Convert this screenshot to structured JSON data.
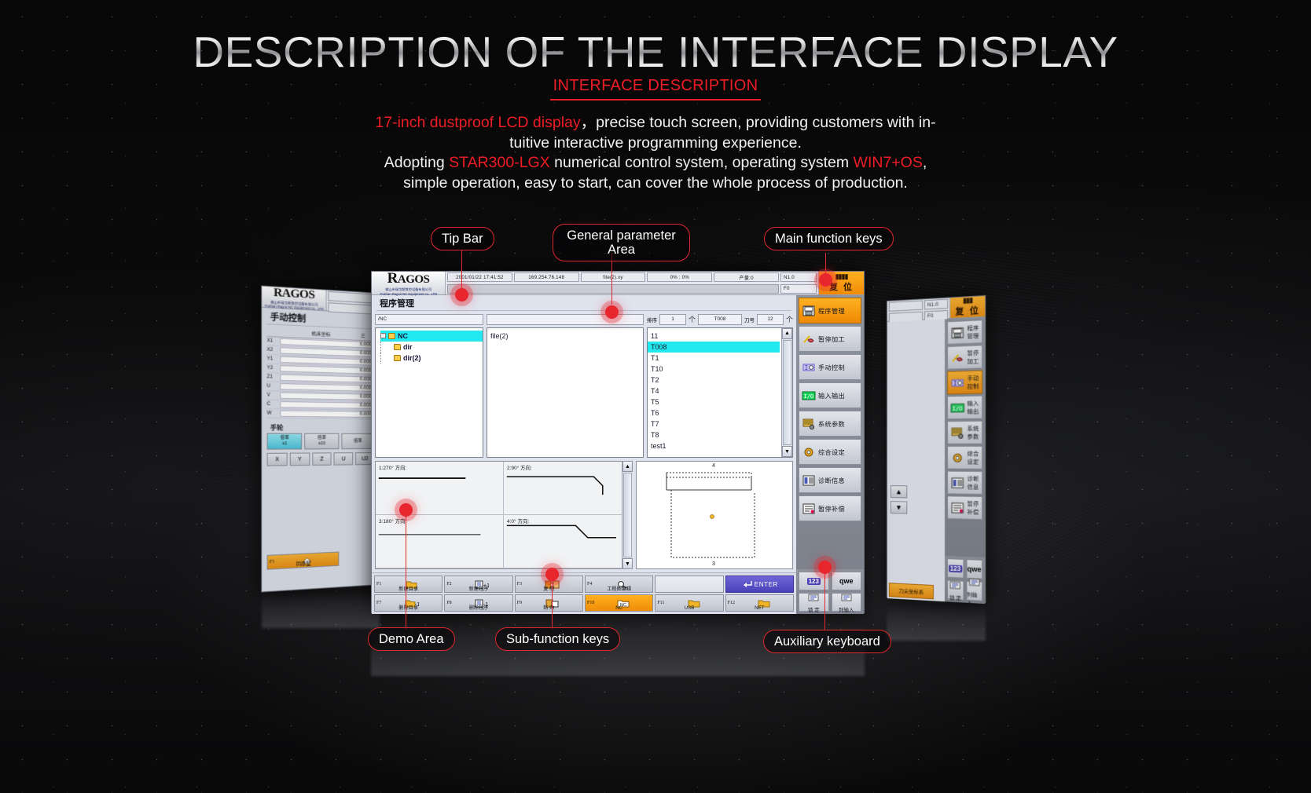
{
  "header": {
    "title": "DESCRIPTION OF THE INTERFACE DISPLAY",
    "subtitle": "INTERFACE DESCRIPTION",
    "para_line1_red": "17-inch dustproof LCD display",
    "para_line1_rest": "，precise touch screen, providing customers with in-",
    "para_line2": "tuitive interactive programming experience.",
    "para_line3_a": "Adopting ",
    "para_line3_red": "STAR300-LGX",
    "para_line3_b": " numerical control system, operating system ",
    "para_line3_red2": "WIN7+OS",
    "para_line3_c": ",",
    "para_line4": "simple operation, easy to start, can cover the whole process of production."
  },
  "callouts": [
    {
      "id": "tip-bar",
      "label": "Tip Bar"
    },
    {
      "id": "general-parameter-area",
      "label": "General parameter\nArea"
    },
    {
      "id": "main-function-keys",
      "label": "Main function keys"
    },
    {
      "id": "demo-area",
      "label": "Demo Area"
    },
    {
      "id": "sub-function-keys",
      "label": "Sub-function keys"
    },
    {
      "id": "auxiliary-keyboard",
      "label": "Auxiliary keyboard"
    }
  ],
  "colors": {
    "accent_red": "#ee1c25",
    "callout_border": "#e2272e",
    "highlight_orange": "#ef8c06",
    "selection_cyan": "#22e9f0"
  },
  "cnc": {
    "brand": {
      "logo_r": "R",
      "logo_rest": "AGOS",
      "company_cn": "佛山市瑞戈斯数控设备有限公司",
      "company_en": "Foshan Ragos NC Equipment co., LTD"
    },
    "status_bar": {
      "datetime": "2001/01/22 17:41:52",
      "ip": "169.254.76.148",
      "file": "file(2).xy",
      "progress": "0% : 0%",
      "output": "产量:0",
      "speed_n": "N1.0",
      "speed_f": "F0",
      "tip_placeholder": ""
    },
    "section_title": "程序管理",
    "path_field": "/NC",
    "name_field": "",
    "sort_label": "排序",
    "sort_value": "1",
    "tool_field": "T008",
    "tool_no_label": "刀号",
    "tool_no_value": "12",
    "tree": [
      {
        "label": "NC",
        "depth": 0,
        "selected": true
      },
      {
        "label": "dir",
        "depth": 1,
        "selected": false
      },
      {
        "label": "dir(2)",
        "depth": 1,
        "selected": false
      }
    ],
    "file_list": [
      "file(2)"
    ],
    "tool_list": [
      {
        "label": "11",
        "selected": false
      },
      {
        "label": "T008",
        "selected": true
      },
      {
        "label": "T1",
        "selected": false
      },
      {
        "label": "T10",
        "selected": false
      },
      {
        "label": "T2",
        "selected": false
      },
      {
        "label": "T4",
        "selected": false
      },
      {
        "label": "T5",
        "selected": false
      },
      {
        "label": "T6",
        "selected": false
      },
      {
        "label": "T7",
        "selected": false
      },
      {
        "label": "T8",
        "selected": false
      },
      {
        "label": "test1",
        "selected": false
      }
    ],
    "demo_cells": [
      {
        "label": "1:270° 方向:"
      },
      {
        "label": "2:90° 方向:"
      },
      {
        "label": "3:180° 方向:"
      },
      {
        "label": "4:0° 方向:"
      }
    ],
    "graph": {
      "top_num": "4",
      "bottom_num": "3"
    },
    "sub_function_keys": [
      {
        "key": "F1",
        "caption": "新建目录",
        "icon": "folder-icon",
        "style": "normal"
      },
      {
        "key": "F2",
        "caption": "新建程序",
        "icon": "new-file-icon",
        "style": "normal"
      },
      {
        "key": "F3",
        "caption": "复 制",
        "icon": "copy-icon",
        "style": "normal"
      },
      {
        "key": "F4",
        "caption": "工程图编辑",
        "icon": "magnifier-icon",
        "style": "normal"
      },
      {
        "key": "",
        "caption": "",
        "icon": "",
        "style": "blank"
      },
      {
        "key": "",
        "caption": "ENTER",
        "icon": "enter-icon",
        "style": "violet"
      },
      {
        "key": "F7",
        "caption": "删除目录",
        "icon": "folder-minus-icon",
        "style": "normal"
      },
      {
        "key": "F8",
        "caption": "删除程序",
        "icon": "file-minus-icon",
        "style": "normal"
      },
      {
        "key": "F9",
        "caption": "粘 贴",
        "icon": "paste-icon",
        "style": "normal"
      },
      {
        "key": "F10",
        "caption": "NC",
        "icon": "nc-icon",
        "style": "orange"
      },
      {
        "key": "F11",
        "caption": "USB",
        "icon": "usb-icon",
        "style": "normal"
      },
      {
        "key": "F12",
        "caption": "NET",
        "icon": "net-icon",
        "style": "normal"
      }
    ],
    "main_function_keys": [
      {
        "label": "程序管理",
        "icon": "program-manage-icon",
        "active": true
      },
      {
        "label": "暂停加工",
        "icon": "pause-machining-icon",
        "active": false
      },
      {
        "label": "手动控制",
        "icon": "manual-control-icon",
        "active": false
      },
      {
        "label": "输入输出",
        "icon": "io-icon",
        "active": false
      },
      {
        "label": "系统参数",
        "icon": "system-params-icon",
        "active": false
      },
      {
        "label": "综合设定",
        "icon": "general-setup-icon",
        "active": false
      },
      {
        "label": "诊断信息",
        "icon": "diagnostics-icon",
        "active": false
      },
      {
        "label": "暂停补偿",
        "icon": "compensation-icon",
        "active": false
      }
    ],
    "aux_keyboard": [
      {
        "glyph": "123",
        "caption": ""
      },
      {
        "glyph": "qwe",
        "caption": ""
      },
      {
        "glyph": "",
        "caption": "锁 定"
      },
      {
        "glyph": "",
        "caption": "列输入"
      }
    ],
    "tool_coord_button": "刀尖坐标系"
  },
  "cnc_left": {
    "brand_logo": "RAGOS",
    "company_cn": "佛山市瑞戈斯数控设备有限公司",
    "company_en": "Foshan Ragos NC Equipment co., LTD",
    "section_title": "手动控制",
    "table_header_left": "机床坐标",
    "axes": [
      {
        "name": "X1",
        "value": "0.000"
      },
      {
        "name": "X2",
        "value": "0.000"
      },
      {
        "name": "Y1",
        "value": "0.000"
      },
      {
        "name": "Y2",
        "value": "0.000"
      },
      {
        "name": "Z1",
        "value": "0.000"
      },
      {
        "name": "U",
        "value": "0.000"
      },
      {
        "name": "V",
        "value": "0.000"
      },
      {
        "name": "C",
        "value": "0.000"
      },
      {
        "name": "W",
        "value": "0.000"
      }
    ],
    "handwheel_label": "手轮",
    "rate_keys": [
      "倍率\nx1",
      "倍率\nx10",
      "倍率"
    ],
    "axis_keys": [
      "X",
      "Y",
      "Z",
      "U",
      "U2"
    ],
    "fkey": {
      "key": "F1",
      "caption": "回原墅"
    }
  },
  "cnc_right": {
    "status": {
      "speed_n": "N1.0",
      "speed_f": "F0"
    },
    "reset_label": "复 位",
    "main_function_keys": [
      {
        "label": "程序管理",
        "icon": "program-manage-icon",
        "active": false
      },
      {
        "label": "暂停加工",
        "icon": "pause-machining-icon",
        "active": false
      },
      {
        "label": "手动控制",
        "icon": "manual-control-icon",
        "active": true
      },
      {
        "label": "输入输出",
        "icon": "io-icon",
        "active": false
      },
      {
        "label": "系统参数",
        "icon": "system-params-icon",
        "active": false
      },
      {
        "label": "综合设定",
        "icon": "general-setup-icon",
        "active": false
      },
      {
        "label": "诊断信息",
        "icon": "diagnostics-icon",
        "active": false
      },
      {
        "label": "暂停补偿",
        "icon": "compensation-icon",
        "active": false
      }
    ],
    "aux_keyboard": [
      {
        "glyph": "123",
        "caption": ""
      },
      {
        "glyph": "qwe",
        "caption": ""
      },
      {
        "glyph": "",
        "caption": "锁 定"
      },
      {
        "glyph": "",
        "caption": "列输入"
      }
    ],
    "tool_coord_button": "刀尖坐标系"
  }
}
